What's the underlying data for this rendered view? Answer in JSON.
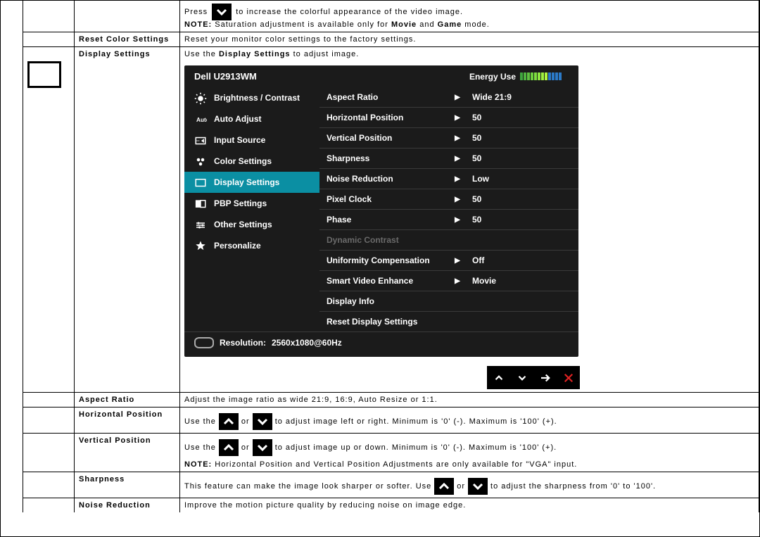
{
  "row_saturation": {
    "press_pre": "Press ",
    "press_post": " to increase the colorful appearance of the video image.",
    "note_label": "NOTE:",
    "note_a": " Saturation adjustment is available only for ",
    "movie": "Movie",
    "note_b": " and ",
    "game": "Game",
    "note_c": " mode."
  },
  "rows": {
    "reset_color": {
      "label": "Reset Color Settings",
      "text": "Reset your monitor color settings to the factory settings."
    },
    "display_settings": {
      "label": "Display Settings",
      "pre": "Use the ",
      "bold": "Display Settings",
      "post": " to adjust image."
    },
    "aspect_ratio": {
      "label": "Aspect Ratio",
      "text": "Adjust the image ratio as wide 21:9, 16:9, Auto Resize or 1:1."
    },
    "hpos": {
      "label": "Horizontal Position",
      "pre": "Use the ",
      "mid": " or ",
      "post": " to adjust image left or right. Minimum is '0' (-). Maximum is '100' (+)."
    },
    "vpos": {
      "label": "Vertical Position",
      "pre": "Use the ",
      "mid": " or ",
      "post": " to adjust image up or down. Minimum is '0' (-). Maximum is '100' (+).",
      "note_label": "NOTE:",
      "note": " Horizontal Position and Vertical Position Adjustments are only available for \"VGA\" input."
    },
    "sharpness": {
      "label": "Sharpness",
      "pre": "This feature can make the image look sharper or softer. Use ",
      "mid": " or ",
      "post": " to adjust the sharpness from '0' to '100'."
    },
    "noise": {
      "label": "Noise Reduction",
      "text": "Improve the motion picture quality by reducing noise on image edge."
    }
  },
  "osd": {
    "title": "Dell U2913WM",
    "energy_label": "Energy Use",
    "menu": [
      {
        "label": "Brightness / Contrast"
      },
      {
        "label": "Auto Adjust"
      },
      {
        "label": "Input Source"
      },
      {
        "label": "Color Settings"
      },
      {
        "label": "Display Settings"
      },
      {
        "label": "PBP Settings"
      },
      {
        "label": "Other Settings"
      },
      {
        "label": "Personalize"
      }
    ],
    "items": [
      {
        "label": "Aspect Ratio",
        "arrow": true,
        "value": "Wide 21:9"
      },
      {
        "label": "Horizontal Position",
        "arrow": true,
        "value": "50"
      },
      {
        "label": "Vertical Position",
        "arrow": true,
        "value": "50"
      },
      {
        "label": "Sharpness",
        "arrow": true,
        "value": "50"
      },
      {
        "label": "Noise Reduction",
        "arrow": true,
        "value": "Low"
      },
      {
        "label": "Pixel Clock",
        "arrow": true,
        "value": "50"
      },
      {
        "label": "Phase",
        "arrow": true,
        "value": "50"
      },
      {
        "label": "Dynamic Contrast",
        "arrow": false,
        "value": "",
        "disabled": true
      },
      {
        "label": "Uniformity Compensation",
        "arrow": true,
        "value": "Off"
      },
      {
        "label": "Smart Video Enhance",
        "arrow": true,
        "value": "Movie"
      },
      {
        "label": "Display Info",
        "arrow": false,
        "value": ""
      },
      {
        "label": "Reset Display Settings",
        "arrow": false,
        "value": ""
      }
    ],
    "resolution_label": "Resolution:",
    "resolution_value": "2560x1080@60Hz",
    "energy_colors": [
      "#3fa63f",
      "#4fb440",
      "#5fc240",
      "#6fd040",
      "#7fde40",
      "#8fe840",
      "#9ff040",
      "#aff640",
      "#2b7ac8",
      "#2b7ac8",
      "#2b7ac8",
      "#2b7ac8",
      "#1a1a1a",
      "#1a1a1a"
    ]
  }
}
